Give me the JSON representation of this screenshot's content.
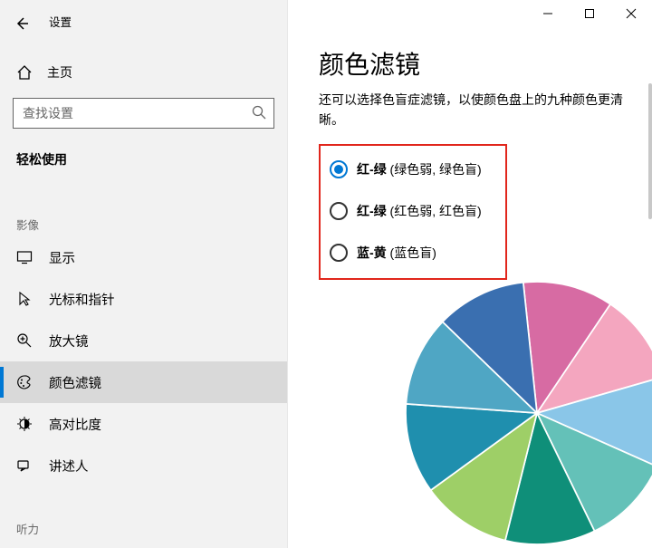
{
  "window": {
    "settings_label": "设置"
  },
  "sidebar": {
    "home_label": "主页",
    "search_placeholder": "查找设置",
    "group_name": "轻松使用",
    "section_video_label": "影像",
    "items": [
      {
        "label": "显示"
      },
      {
        "label": "光标和指针"
      },
      {
        "label": "放大镜"
      },
      {
        "label": "颜色滤镜"
      },
      {
        "label": "高对比度"
      },
      {
        "label": "讲述人"
      }
    ],
    "section_audio_label": "听力"
  },
  "content": {
    "title": "颜色滤镜",
    "description": "还可以选择色盲症滤镜，以使颜色盘上的九种颜色更清晰。",
    "radios": [
      {
        "bold": "红-绿",
        "rest": " (绿色弱, 绿色盲)",
        "selected": true
      },
      {
        "bold": "红-绿",
        "rest": " (红色弱, 红色盲)",
        "selected": false
      },
      {
        "bold": "蓝-黄",
        "rest": " (蓝色盲)",
        "selected": false
      }
    ]
  },
  "chart_data": {
    "type": "pie",
    "title": "",
    "slices": [
      {
        "label": "",
        "value": 1,
        "color": "#d76ba3"
      },
      {
        "label": "",
        "value": 1,
        "color": "#f4a6bf"
      },
      {
        "label": "",
        "value": 1,
        "color": "#8ac6e8"
      },
      {
        "label": "",
        "value": 1,
        "color": "#64c1b8"
      },
      {
        "label": "",
        "value": 1,
        "color": "#0f8f79"
      },
      {
        "label": "",
        "value": 1,
        "color": "#9ecf67"
      },
      {
        "label": "",
        "value": 1,
        "color": "#1f8fae"
      },
      {
        "label": "",
        "value": 1,
        "color": "#4fa6c4"
      },
      {
        "label": "",
        "value": 1,
        "color": "#3a6fb0"
      }
    ]
  }
}
